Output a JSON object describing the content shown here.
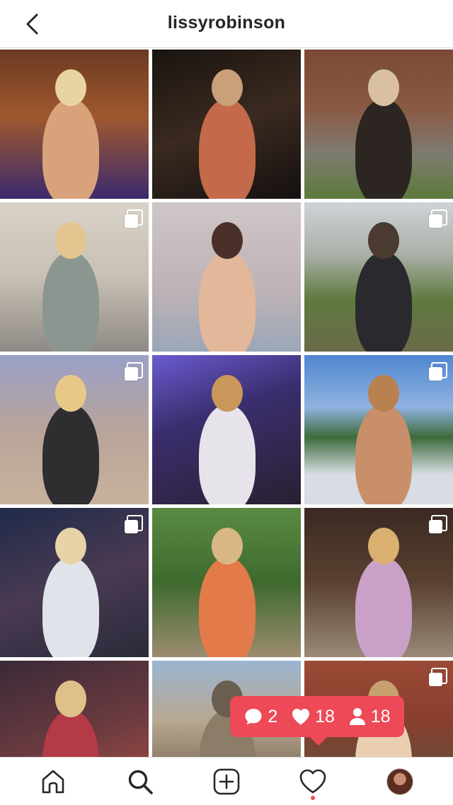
{
  "header": {
    "title": "lissyrobinson",
    "back_icon": "chevron-left-icon"
  },
  "grid": {
    "tiles": [
      {
        "bg": "linear-gradient(180deg,#6b3a22 0%,#a0582e 45%,#3b2a6e 100%)",
        "fig": "#d8a27a",
        "head": "#e9d3a0",
        "multi": false
      },
      {
        "bg": "linear-gradient(160deg,#1a1410 0%,#3a2a20 50%,#151010 100%)",
        "fig": "#c46a4a",
        "head": "#caa07a",
        "multi": false
      },
      {
        "bg": "linear-gradient(180deg,#7a4a36 0%,#8b5a44 40%,#7d7c70 70%,#5c7a3a 100%)",
        "fig": "#2c2522",
        "head": "#d9c0a0",
        "multi": false
      },
      {
        "bg": "linear-gradient(180deg,#d9d2c8 0%,#c8c0b4 50%,#8f8a86 100%)",
        "fig": "#8c9690",
        "head": "#e3c58f",
        "multi": true
      },
      {
        "bg": "linear-gradient(180deg,#cfc6c7 0%,#bdb2b5 60%,#9aa6b8 100%)",
        "fig": "#e3b89a",
        "head": "#4a3028",
        "multi": false
      },
      {
        "bg": "linear-gradient(180deg,#cfd3d6 0%,#aab0a8 35%,#5f7a3e 65%,#6a6a4a 100%)",
        "fig": "#2a2a2e",
        "head": "#4a3a30",
        "multi": true
      },
      {
        "bg": "linear-gradient(180deg,#9aa0c8 0%,#b8a49a 50%,#c7b29c 100%)",
        "fig": "#2e2e30",
        "head": "#e7c887",
        "multi": true
      },
      {
        "bg": "linear-gradient(160deg,#6a5bd0 0%,#3a2e6e 40%,#2a2030 100%)",
        "fig": "#e7e3ea",
        "head": "#c9975a",
        "multi": false
      },
      {
        "bg": "linear-gradient(180deg,#4f86d0 0%,#8fb3e0 35%,#3d6a3a 55%,#d7dde3 80%)",
        "fig": "#c98f6a",
        "head": "#b98050",
        "multi": true
      },
      {
        "bg": "linear-gradient(160deg,#1f2a4a 0%,#4a3a52 50%,#2a2a3a 100%)",
        "fig": "#e0e4ea",
        "head": "#e8d3a8",
        "multi": true
      },
      {
        "bg": "linear-gradient(180deg,#5a8a42 0%,#3f6a2e 50%,#9c8c70 100%)",
        "fig": "#e37a4a",
        "head": "#d9b785",
        "multi": false
      },
      {
        "bg": "linear-gradient(180deg,#3a2a22 0%,#5a4030 50%,#9a8a78 100%)",
        "fig": "#c8a0c8",
        "head": "#d9b070",
        "multi": true
      },
      {
        "bg": "linear-gradient(160deg,#3a2a38 0%,#6a3a40 50%,#b05040 100%)",
        "fig": "#b33a46",
        "head": "#e0c08a",
        "multi": false
      },
      {
        "bg": "linear-gradient(180deg,#9bb5d2 0%,#b8a890 40%,#8a7a66 70%,#6f6f70 100%)",
        "fig": "#8c7d68",
        "head": "#6a5e50",
        "multi": false
      },
      {
        "bg": "linear-gradient(180deg,#9a4a36 0%,#8a3e2e 40%,#6a4a3a 70%,#3a2a22 100%)",
        "fig": "#e9cfb0",
        "head": "#c7a070",
        "multi": true
      }
    ]
  },
  "activity": {
    "comments": "2",
    "likes": "18",
    "followers": "18",
    "color": "#ed4956"
  },
  "nav": {
    "items": [
      "home-icon",
      "search-icon",
      "add-post-icon",
      "activity-heart-icon",
      "profile-avatar"
    ]
  }
}
